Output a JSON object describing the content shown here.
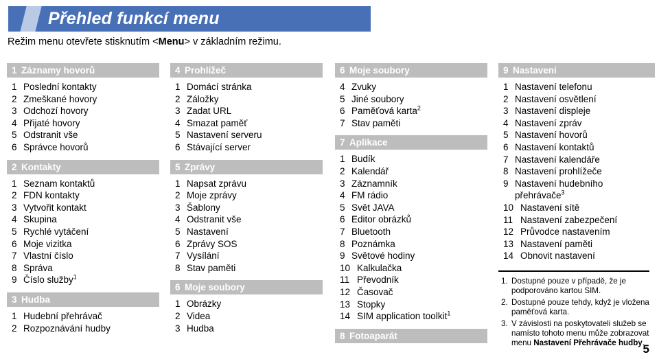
{
  "header": {
    "title": "Přehled funkcí menu",
    "accent_color": "#4870b7",
    "mark_color": "#b9c9e6"
  },
  "subtitle": {
    "before": "Režim menu otevřete stisknutím <",
    "bold": "Menu",
    "after": "> v základním režimu."
  },
  "columns": [
    {
      "sections": [
        {
          "num": "1",
          "title": "Záznamy hovorů",
          "items": [
            {
              "n": "1",
              "text": "Poslední kontakty"
            },
            {
              "n": "2",
              "text": "Zmeškané hovory"
            },
            {
              "n": "3",
              "text": "Odchozí hovory"
            },
            {
              "n": "4",
              "text": "Přijaté hovory"
            },
            {
              "n": "5",
              "text": "Odstranit vše"
            },
            {
              "n": "6",
              "text": "Správce hovorů"
            }
          ]
        },
        {
          "num": "2",
          "title": "Kontakty",
          "items": [
            {
              "n": "1",
              "text": "Seznam kontaktů"
            },
            {
              "n": "2",
              "text": "FDN kontakty"
            },
            {
              "n": "3",
              "text": "Vytvořit kontakt"
            },
            {
              "n": "4",
              "text": "Skupina"
            },
            {
              "n": "5",
              "text": "Rychlé vytáčení"
            },
            {
              "n": "6",
              "text": "Moje vizitka"
            },
            {
              "n": "7",
              "text": "Vlastní číslo"
            },
            {
              "n": "8",
              "text": "Správa"
            },
            {
              "n": "9",
              "text": "Číslo služby",
              "sup": "1"
            }
          ]
        },
        {
          "num": "3",
          "title": "Hudba",
          "items": [
            {
              "n": "1",
              "text": "Hudební přehrávač"
            },
            {
              "n": "2",
              "text": "Rozpoznávání hudby"
            }
          ]
        }
      ]
    },
    {
      "sections": [
        {
          "num": "4",
          "title": "Prohlížeč",
          "items": [
            {
              "n": "1",
              "text": "Domácí stránka"
            },
            {
              "n": "2",
              "text": "Záložky"
            },
            {
              "n": "3",
              "text": "Zadat URL"
            },
            {
              "n": "4",
              "text": "Smazat paměť"
            },
            {
              "n": "5",
              "text": "Nastavení serveru"
            },
            {
              "n": "6",
              "text": "Stávající server"
            }
          ]
        },
        {
          "num": "5",
          "title": "Zprávy",
          "items": [
            {
              "n": "1",
              "text": "Napsat zprávu"
            },
            {
              "n": "2",
              "text": "Moje zprávy"
            },
            {
              "n": "3",
              "text": "Šablony"
            },
            {
              "n": "4",
              "text": "Odstranit vše"
            },
            {
              "n": "5",
              "text": "Nastavení"
            },
            {
              "n": "6",
              "text": "Zprávy SOS"
            },
            {
              "n": "7",
              "text": "Vysílání"
            },
            {
              "n": "8",
              "text": "Stav paměti"
            }
          ]
        },
        {
          "num": "6",
          "title": "Moje soubory",
          "items": [
            {
              "n": "1",
              "text": "Obrázky"
            },
            {
              "n": "2",
              "text": "Videa"
            },
            {
              "n": "3",
              "text": "Hudba"
            }
          ]
        }
      ]
    },
    {
      "sections": [
        {
          "num": "6",
          "title": "Moje soubory",
          "items": [
            {
              "n": "4",
              "text": "Zvuky"
            },
            {
              "n": "5",
              "text": "Jiné soubory"
            },
            {
              "n": "6",
              "text": "Paměťová karta",
              "sup": "2"
            },
            {
              "n": "7",
              "text": "Stav paměti"
            }
          ]
        },
        {
          "num": "7",
          "title": "Aplikace",
          "items": [
            {
              "n": "1",
              "text": "Budík"
            },
            {
              "n": "2",
              "text": "Kalendář"
            },
            {
              "n": "3",
              "text": "Záznamník"
            },
            {
              "n": "4",
              "text": "FM rádio"
            },
            {
              "n": "5",
              "text": "Svět JAVA"
            },
            {
              "n": "6",
              "text": "Editor obrázků"
            },
            {
              "n": "7",
              "text": "Bluetooth"
            },
            {
              "n": "8",
              "text": "Poznámka"
            },
            {
              "n": "9",
              "text": "Světové hodiny"
            },
            {
              "n": "10",
              "text": "Kalkulačka",
              "wide": true
            },
            {
              "n": "11",
              "text": "Převodník",
              "wide": true
            },
            {
              "n": "12",
              "text": "Časovač",
              "wide": true
            },
            {
              "n": "13",
              "text": "Stopky",
              "wide": true
            },
            {
              "n": "14",
              "text": "SIM application toolkit",
              "sup": "1",
              "wide": true
            }
          ]
        },
        {
          "num": "8",
          "title": "Fotoaparát",
          "items": []
        }
      ]
    },
    {
      "sections": [
        {
          "num": "9",
          "title": "Nastavení",
          "items": [
            {
              "n": "1",
              "text": "Nastavení telefonu"
            },
            {
              "n": "2",
              "text": "Nastavení osvětlení"
            },
            {
              "n": "3",
              "text": "Nastavení displeje"
            },
            {
              "n": "4",
              "text": "Nastavení zpráv"
            },
            {
              "n": "5",
              "text": "Nastavení hovorů"
            },
            {
              "n": "6",
              "text": "Nastavení kontaktů"
            },
            {
              "n": "7",
              "text": "Nastavení kalendáře"
            },
            {
              "n": "8",
              "text": "Nastavení prohlížeče"
            },
            {
              "n": "9",
              "text": "Nastavení hudebního",
              "text2": "přehrávače",
              "sup": "3"
            },
            {
              "n": "10",
              "text": "Nastavení sítě",
              "wide": true
            },
            {
              "n": "11",
              "text": "Nastavení zabezpečení",
              "wide": true
            },
            {
              "n": "12",
              "text": "Průvodce nastavením",
              "wide": true
            },
            {
              "n": "13",
              "text": "Nastavení paměti",
              "wide": true
            },
            {
              "n": "14",
              "text": "Obnovit nastavení",
              "wide": true
            }
          ]
        }
      ],
      "footnotes": [
        {
          "n": "1.",
          "text": "Dostupné pouze v případě, že je podporováno kartou SIM."
        },
        {
          "n": "2.",
          "text": "Dostupné pouze tehdy, když je vložena paměťová karta."
        },
        {
          "n": "3.",
          "before": "V závislosti na poskytovateli služeb se namísto tohoto menu může zobrazovat menu ",
          "bold": "Nastavení Přehrávače hudby",
          "after": "."
        }
      ]
    }
  ],
  "page_number": "5"
}
